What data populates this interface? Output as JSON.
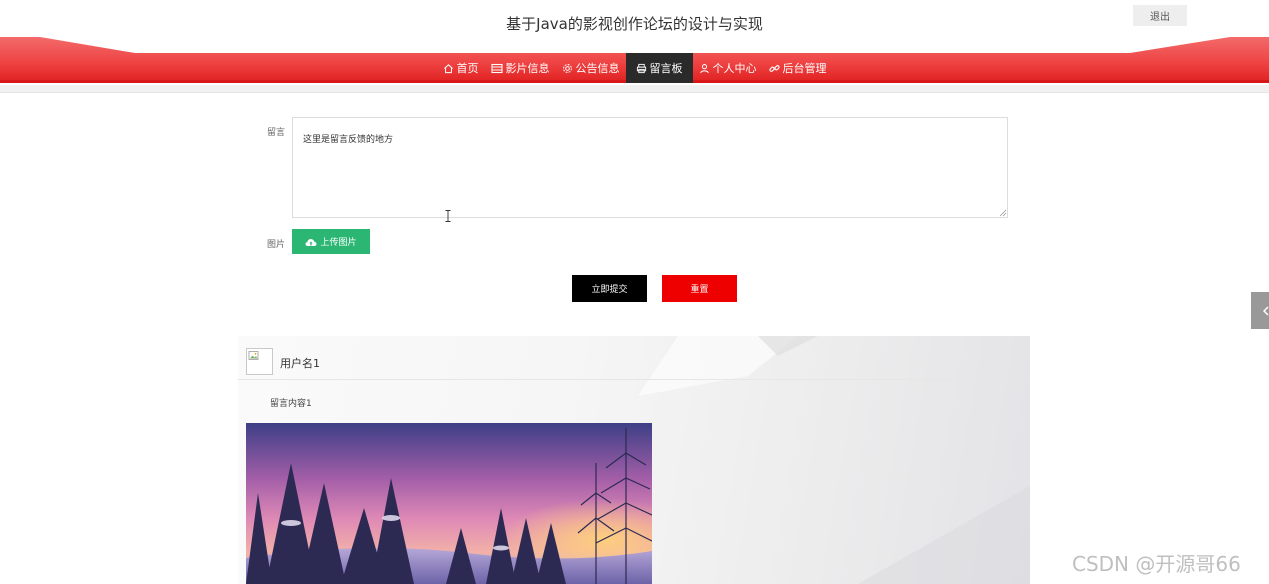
{
  "header": {
    "title": "基于Java的影视创作论坛的设计与实现",
    "logout_label": "退出"
  },
  "nav": {
    "items": [
      {
        "label": "首页",
        "icon": "home-icon"
      },
      {
        "label": "影片信息",
        "icon": "film-icon"
      },
      {
        "label": "公告信息",
        "icon": "gear-icon"
      },
      {
        "label": "留言板",
        "icon": "printer-icon",
        "active": true
      },
      {
        "label": "个人中心",
        "icon": "user-icon"
      },
      {
        "label": "后台管理",
        "icon": "link-icon"
      }
    ]
  },
  "form": {
    "message_label": "留言",
    "message_value": "这里是留言反馈的地方",
    "image_label": "图片",
    "upload_label": "上传图片",
    "submit_label": "立即提交",
    "reset_label": "重置"
  },
  "messages": [
    {
      "username": "用户名1",
      "content": "留言内容1"
    }
  ],
  "watermark": "CSDN @开源哥66",
  "colors": {
    "nav_red": "#f04a4a",
    "active_nav": "#2a2a2a",
    "upload_green": "#2bb673",
    "submit_black": "#000000",
    "reset_red": "#ee0000"
  }
}
